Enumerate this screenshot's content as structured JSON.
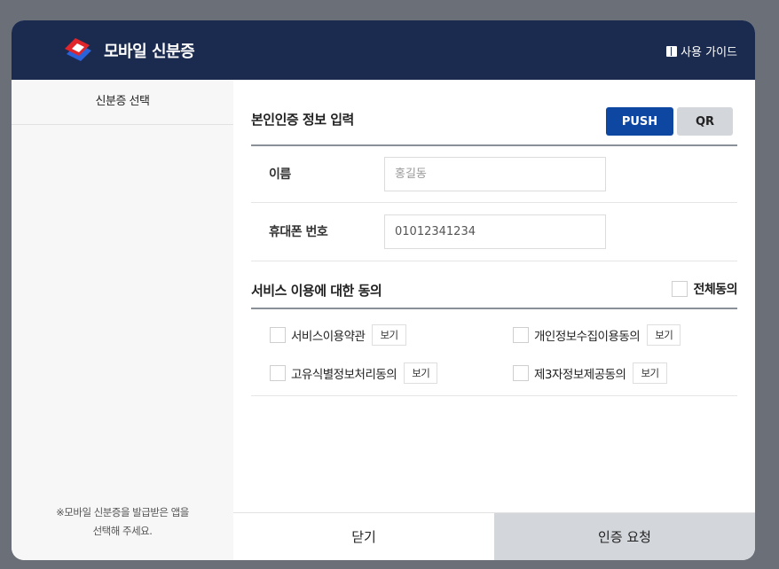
{
  "header": {
    "app_title": "모바일 신분증",
    "guide_label": "사용 가이드"
  },
  "sidebar": {
    "heading": "신분증 선택",
    "note_line1": "※모바일 신분증을 발급받은 앱을",
    "note_line2": "선택해 주세요."
  },
  "identity_form": {
    "title": "본인인증 정보 입력",
    "push_label": "PUSH",
    "qr_label": "QR",
    "name_label": "이름",
    "name_placeholder": "홍길동",
    "phone_label": "휴대폰 번호",
    "phone_value": "01012341234"
  },
  "consent": {
    "title": "서비스 이용에 대한 동의",
    "all_label": "전체동의",
    "view_label": "보기",
    "items": [
      {
        "label": "서비스이용약관"
      },
      {
        "label": "개인정보수집이용동의"
      },
      {
        "label": "고유식별정보처리동의"
      },
      {
        "label": "제3자정보제공동의"
      }
    ]
  },
  "footer": {
    "close_label": "닫기",
    "request_label": "인증 요청"
  },
  "colors": {
    "header_bg": "#1b2b4f",
    "push_button": "#0d47a1",
    "secondary_button": "#d3d6db"
  }
}
